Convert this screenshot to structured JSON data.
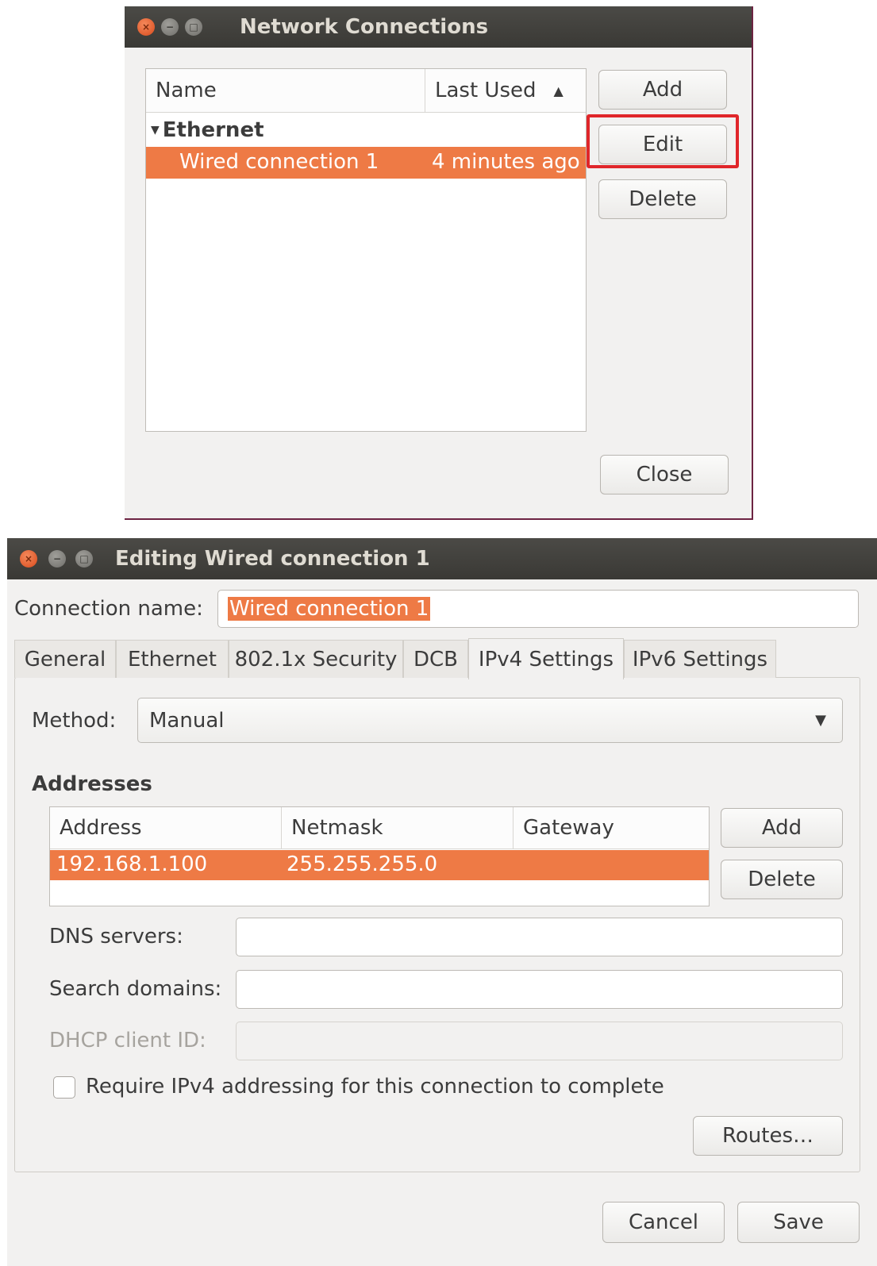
{
  "netconn": {
    "title": "Network Connections",
    "col_name": "Name",
    "col_last_used": "Last Used",
    "group": "Ethernet",
    "row": {
      "name": "Wired connection 1",
      "last_used": "4 minutes ago"
    },
    "buttons": {
      "add": "Add",
      "edit": "Edit",
      "delete": "Delete",
      "close": "Close"
    },
    "highlight_color": "#e0262a"
  },
  "editor": {
    "title": "Editing Wired connection 1",
    "conn_name_label": "Connection name:",
    "conn_name_value": "Wired connection 1",
    "tabs": [
      "General",
      "Ethernet",
      "802.1x Security",
      "DCB",
      "IPv4 Settings",
      "IPv6 Settings"
    ],
    "method_label": "Method:",
    "method_value": "Manual",
    "addresses_heading": "Addresses",
    "addr_cols": [
      "Address",
      "Netmask",
      "Gateway"
    ],
    "addr_row": {
      "address": "192.168.1.100",
      "netmask": "255.255.255.0",
      "gateway": ""
    },
    "addr_add": "Add",
    "addr_delete": "Delete",
    "dns_label": "DNS servers:",
    "search_label": "Search domains:",
    "dhcp_label": "DHCP client ID:",
    "require_label": "Require IPv4 addressing for this connection to complete",
    "routes": "Routes…",
    "cancel": "Cancel",
    "save": "Save"
  },
  "colors": {
    "accent": "#ee7a45",
    "titlebar": "#3c3b37"
  }
}
